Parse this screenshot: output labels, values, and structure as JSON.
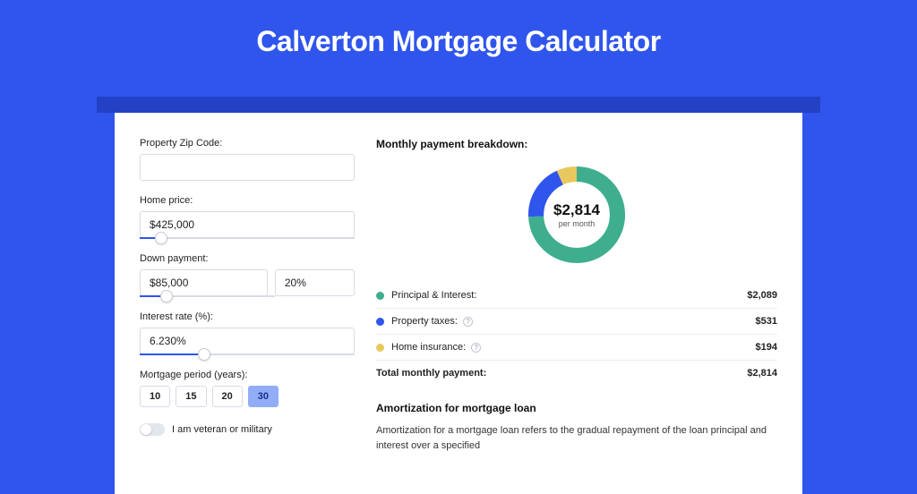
{
  "title": "Calverton Mortgage Calculator",
  "colors": {
    "principal": "#3fae8f",
    "taxes": "#2f55ed",
    "insurance": "#e9c85f"
  },
  "form": {
    "zip_label": "Property Zip Code:",
    "zip_value": "",
    "home_price_label": "Home price:",
    "home_price_value": "$425,000",
    "home_price_slider_pct": 10,
    "down_label": "Down payment:",
    "down_value": "$85,000",
    "down_pct_value": "20%",
    "down_slider_pct": 20,
    "rate_label": "Interest rate (%):",
    "rate_value": "6.230%",
    "rate_slider_pct": 30,
    "period_label": "Mortgage period (years):",
    "period_options": [
      "10",
      "15",
      "20",
      "30"
    ],
    "period_selected": "30",
    "veteran_label": "I am veteran or military",
    "veteran_on": false
  },
  "breakdown": {
    "title": "Monthly payment breakdown:",
    "center_amount": "$2,814",
    "center_sub": "per month",
    "items": [
      {
        "key": "principal",
        "label": "Principal & Interest:",
        "value": "$2,089",
        "info": false
      },
      {
        "key": "taxes",
        "label": "Property taxes:",
        "value": "$531",
        "info": true
      },
      {
        "key": "insurance",
        "label": "Home insurance:",
        "value": "$194",
        "info": true
      }
    ],
    "total_label": "Total monthly payment:",
    "total_value": "$2,814"
  },
  "chart_data": {
    "type": "pie",
    "title": "Monthly payment breakdown",
    "series": [
      {
        "name": "Principal & Interest",
        "value": 2089,
        "color": "#3fae8f"
      },
      {
        "name": "Property taxes",
        "value": 531,
        "color": "#2f55ed"
      },
      {
        "name": "Home insurance",
        "value": 194,
        "color": "#e9c85f"
      }
    ],
    "total": 2814
  },
  "amortization": {
    "title": "Amortization for mortgage loan",
    "text": "Amortization for a mortgage loan refers to the gradual repayment of the loan principal and interest over a specified"
  }
}
